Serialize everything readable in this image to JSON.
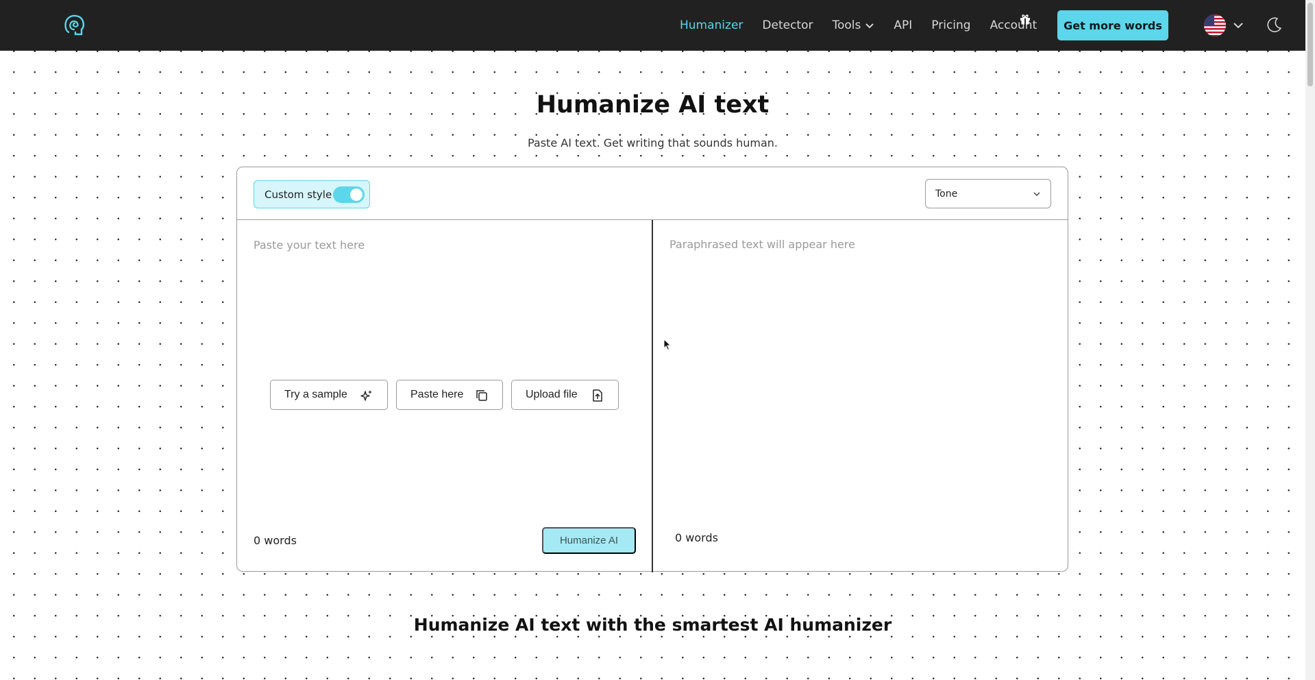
{
  "nav": {
    "links": [
      {
        "label": "Humanizer",
        "active": true
      },
      {
        "label": "Detector",
        "active": false
      },
      {
        "label": "Tools",
        "active": false,
        "has_dropdown": true
      },
      {
        "label": "API",
        "active": false
      },
      {
        "label": "Pricing",
        "active": false
      },
      {
        "label": "Account",
        "active": false
      }
    ],
    "cta_label": "Get more words",
    "icons": {
      "logo": "head-spiral-logo",
      "gift": "gift-icon",
      "language": "us-flag-icon",
      "theme": "moon-icon"
    }
  },
  "hero": {
    "title": "Humanize AI text",
    "subtitle": "Paste AI text. Get writing that sounds human."
  },
  "editor": {
    "custom_style_label": "Custom style",
    "custom_style_on": true,
    "tone_selected": "Tone",
    "input_placeholder": "Paste your text here",
    "output_placeholder": "Paraphrased text will appear here",
    "actions": {
      "sample_label": "Try a sample",
      "paste_label": "Paste here",
      "upload_label": "Upload file"
    },
    "input_word_count": "0 words",
    "output_word_count": "0 words",
    "humanize_label": "Humanize AI"
  },
  "section": {
    "title": "Humanize AI text with the smartest AI humanizer"
  },
  "colors": {
    "accent": "#5bd6ea",
    "nav_bg": "#212121",
    "accent_light": "#d6f6fb"
  }
}
